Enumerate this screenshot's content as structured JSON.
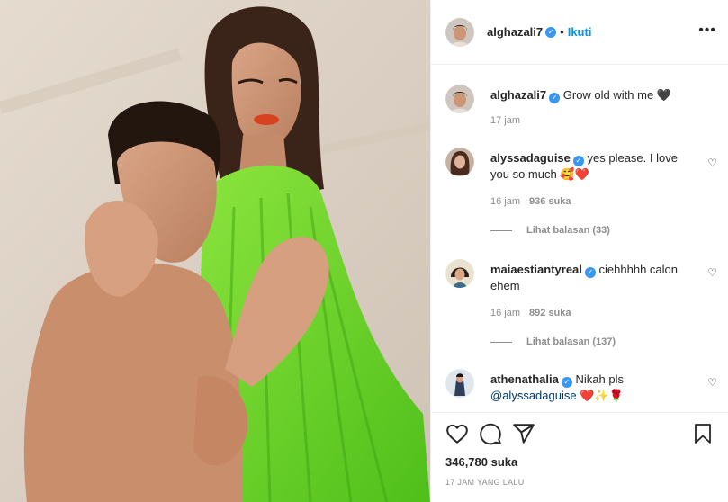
{
  "post": {
    "author": "alghazali7",
    "follow_label": "Ikuti",
    "more_icon": "more-options-icon",
    "caption": {
      "username": "alghazali7",
      "text": "Grow old with me 🖤",
      "time": "17 jam"
    },
    "comments": [
      {
        "username": "alyssadaguise",
        "text": "yes please. I love you so much 🥰❤️",
        "time": "16 jam",
        "likes": "936 suka",
        "replies": "Lihat balasan (33)"
      },
      {
        "username": "maiaestiantyreal",
        "text": "ciehhhhh calon ehem",
        "time": "16 jam",
        "likes": "892 suka",
        "replies": "Lihat balasan (137)"
      },
      {
        "username": "athenathalia",
        "text": "Nikah pls",
        "mention": "@alyssadaguise",
        "emoji": "❤️✨🌹"
      }
    ],
    "likes_count": "346,780 suka",
    "timestamp": "17 JAM YANG LALU"
  },
  "colors": {
    "follow": "#0095f6",
    "verified": "#3897f0",
    "muted": "#8e8e8e",
    "dress": "#6bd42a"
  }
}
